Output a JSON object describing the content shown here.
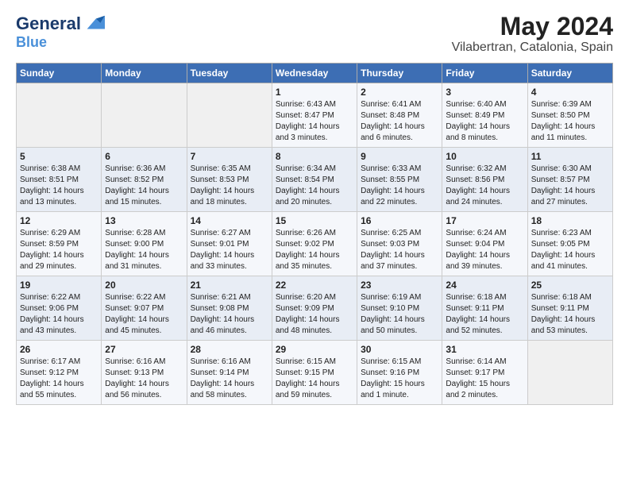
{
  "header": {
    "logo_line1": "General",
    "logo_line2": "Blue",
    "title": "May 2024",
    "subtitle": "Vilabertran, Catalonia, Spain"
  },
  "columns": [
    "Sunday",
    "Monday",
    "Tuesday",
    "Wednesday",
    "Thursday",
    "Friday",
    "Saturday"
  ],
  "weeks": [
    [
      {
        "day": "",
        "info": ""
      },
      {
        "day": "",
        "info": ""
      },
      {
        "day": "",
        "info": ""
      },
      {
        "day": "1",
        "info": "Sunrise: 6:43 AM\nSunset: 8:47 PM\nDaylight: 14 hours\nand 3 minutes."
      },
      {
        "day": "2",
        "info": "Sunrise: 6:41 AM\nSunset: 8:48 PM\nDaylight: 14 hours\nand 6 minutes."
      },
      {
        "day": "3",
        "info": "Sunrise: 6:40 AM\nSunset: 8:49 PM\nDaylight: 14 hours\nand 8 minutes."
      },
      {
        "day": "4",
        "info": "Sunrise: 6:39 AM\nSunset: 8:50 PM\nDaylight: 14 hours\nand 11 minutes."
      }
    ],
    [
      {
        "day": "5",
        "info": "Sunrise: 6:38 AM\nSunset: 8:51 PM\nDaylight: 14 hours\nand 13 minutes."
      },
      {
        "day": "6",
        "info": "Sunrise: 6:36 AM\nSunset: 8:52 PM\nDaylight: 14 hours\nand 15 minutes."
      },
      {
        "day": "7",
        "info": "Sunrise: 6:35 AM\nSunset: 8:53 PM\nDaylight: 14 hours\nand 18 minutes."
      },
      {
        "day": "8",
        "info": "Sunrise: 6:34 AM\nSunset: 8:54 PM\nDaylight: 14 hours\nand 20 minutes."
      },
      {
        "day": "9",
        "info": "Sunrise: 6:33 AM\nSunset: 8:55 PM\nDaylight: 14 hours\nand 22 minutes."
      },
      {
        "day": "10",
        "info": "Sunrise: 6:32 AM\nSunset: 8:56 PM\nDaylight: 14 hours\nand 24 minutes."
      },
      {
        "day": "11",
        "info": "Sunrise: 6:30 AM\nSunset: 8:57 PM\nDaylight: 14 hours\nand 27 minutes."
      }
    ],
    [
      {
        "day": "12",
        "info": "Sunrise: 6:29 AM\nSunset: 8:59 PM\nDaylight: 14 hours\nand 29 minutes."
      },
      {
        "day": "13",
        "info": "Sunrise: 6:28 AM\nSunset: 9:00 PM\nDaylight: 14 hours\nand 31 minutes."
      },
      {
        "day": "14",
        "info": "Sunrise: 6:27 AM\nSunset: 9:01 PM\nDaylight: 14 hours\nand 33 minutes."
      },
      {
        "day": "15",
        "info": "Sunrise: 6:26 AM\nSunset: 9:02 PM\nDaylight: 14 hours\nand 35 minutes."
      },
      {
        "day": "16",
        "info": "Sunrise: 6:25 AM\nSunset: 9:03 PM\nDaylight: 14 hours\nand 37 minutes."
      },
      {
        "day": "17",
        "info": "Sunrise: 6:24 AM\nSunset: 9:04 PM\nDaylight: 14 hours\nand 39 minutes."
      },
      {
        "day": "18",
        "info": "Sunrise: 6:23 AM\nSunset: 9:05 PM\nDaylight: 14 hours\nand 41 minutes."
      }
    ],
    [
      {
        "day": "19",
        "info": "Sunrise: 6:22 AM\nSunset: 9:06 PM\nDaylight: 14 hours\nand 43 minutes."
      },
      {
        "day": "20",
        "info": "Sunrise: 6:22 AM\nSunset: 9:07 PM\nDaylight: 14 hours\nand 45 minutes."
      },
      {
        "day": "21",
        "info": "Sunrise: 6:21 AM\nSunset: 9:08 PM\nDaylight: 14 hours\nand 46 minutes."
      },
      {
        "day": "22",
        "info": "Sunrise: 6:20 AM\nSunset: 9:09 PM\nDaylight: 14 hours\nand 48 minutes."
      },
      {
        "day": "23",
        "info": "Sunrise: 6:19 AM\nSunset: 9:10 PM\nDaylight: 14 hours\nand 50 minutes."
      },
      {
        "day": "24",
        "info": "Sunrise: 6:18 AM\nSunset: 9:11 PM\nDaylight: 14 hours\nand 52 minutes."
      },
      {
        "day": "25",
        "info": "Sunrise: 6:18 AM\nSunset: 9:11 PM\nDaylight: 14 hours\nand 53 minutes."
      }
    ],
    [
      {
        "day": "26",
        "info": "Sunrise: 6:17 AM\nSunset: 9:12 PM\nDaylight: 14 hours\nand 55 minutes."
      },
      {
        "day": "27",
        "info": "Sunrise: 6:16 AM\nSunset: 9:13 PM\nDaylight: 14 hours\nand 56 minutes."
      },
      {
        "day": "28",
        "info": "Sunrise: 6:16 AM\nSunset: 9:14 PM\nDaylight: 14 hours\nand 58 minutes."
      },
      {
        "day": "29",
        "info": "Sunrise: 6:15 AM\nSunset: 9:15 PM\nDaylight: 14 hours\nand 59 minutes."
      },
      {
        "day": "30",
        "info": "Sunrise: 6:15 AM\nSunset: 9:16 PM\nDaylight: 15 hours\nand 1 minute."
      },
      {
        "day": "31",
        "info": "Sunrise: 6:14 AM\nSunset: 9:17 PM\nDaylight: 15 hours\nand 2 minutes."
      },
      {
        "day": "",
        "info": ""
      }
    ]
  ]
}
